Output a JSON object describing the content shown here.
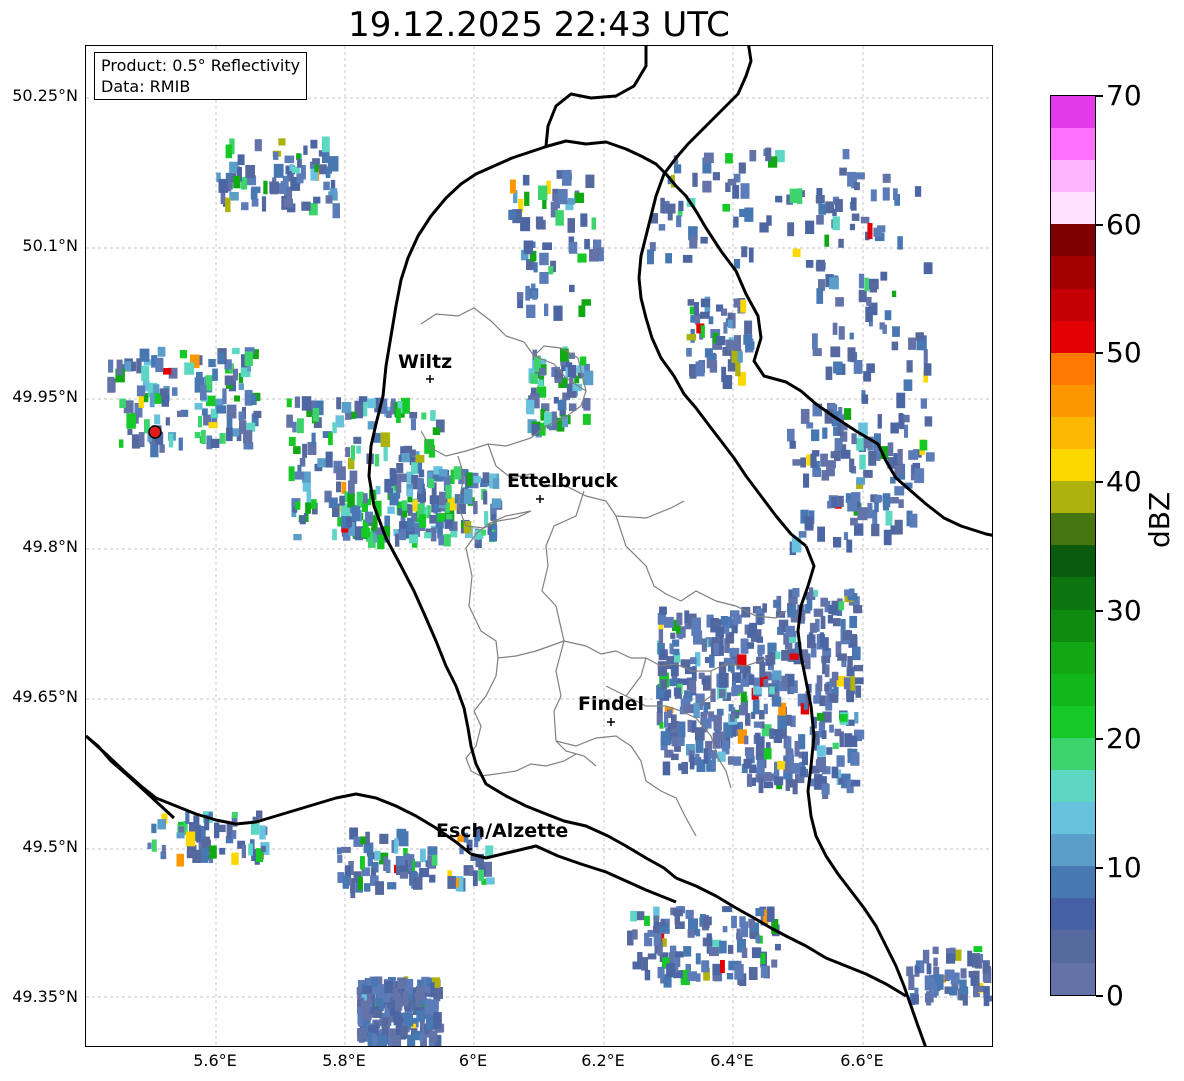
{
  "title": "19.12.2025 22:43 UTC",
  "info": {
    "product": "Product: 0.5° Reflectivity",
    "data": "Data: RMIB"
  },
  "map": {
    "lat_ticks": [
      "50.25°N",
      "50.1°N",
      "49.95°N",
      "49.8°N",
      "49.65°N",
      "49.5°N",
      "49.35°N"
    ],
    "lon_ticks": [
      "5.6°E",
      "5.8°E",
      "6°E",
      "6.2°E",
      "6.4°E",
      "6.6°E"
    ],
    "cities": [
      {
        "name": "Wiltz"
      },
      {
        "name": "Ettelbruck"
      },
      {
        "name": "Findel"
      },
      {
        "name": "Esch/Alzette"
      }
    ],
    "radar_site_color": "#e41a1c"
  },
  "colorbar": {
    "label": "dBZ",
    "ticks": [
      "70",
      "60",
      "50",
      "40",
      "30",
      "20",
      "10",
      "0"
    ],
    "colors": [
      "#6373a8",
      "#56699f",
      "#4660a6",
      "#4878b2",
      "#5b9ec9",
      "#68c2de",
      "#5dd7c4",
      "#3ed46d",
      "#15c926",
      "#12b71b",
      "#12a814",
      "#108b11",
      "#0d7510",
      "#0a5b0d",
      "#467610",
      "#aeb20c",
      "#fdd800",
      "#fbb800",
      "#fc9700",
      "#ff7900",
      "#e30004",
      "#c40004",
      "#a20000",
      "#7e0000",
      "#ffe0ff",
      "#ffb4ff",
      "#ff70ff",
      "#e23ae8"
    ]
  }
}
